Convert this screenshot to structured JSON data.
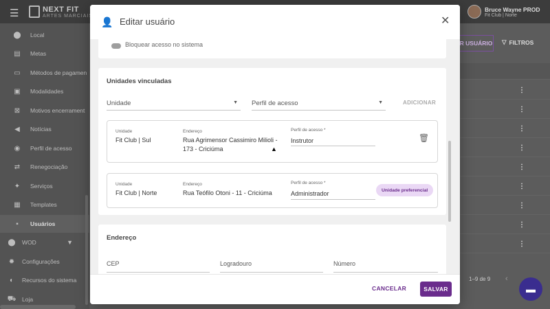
{
  "app": {
    "brand_name": "NEXT FIT",
    "brand_sub": "ARTES MARCIAIS",
    "user_name": "Bruce Wayne PROD",
    "user_unit": "Fit Club | Norte"
  },
  "sidebar": {
    "items": [
      {
        "label": "Local",
        "icon": "pin-icon"
      },
      {
        "label": "Metas",
        "icon": "chart-icon"
      },
      {
        "label": "Métodos de pagamen",
        "icon": "card-icon"
      },
      {
        "label": "Modalidades",
        "icon": "list-icon"
      },
      {
        "label": "Motivos encerrament",
        "icon": "close-box-icon"
      },
      {
        "label": "Notícias",
        "icon": "megaphone-icon"
      },
      {
        "label": "Perfil de acesso",
        "icon": "eye-icon"
      },
      {
        "label": "Renegociação",
        "icon": "swap-icon"
      },
      {
        "label": "Serviços",
        "icon": "wrench-icon"
      },
      {
        "label": "Templates",
        "icon": "template-icon"
      },
      {
        "label": "Usuários",
        "icon": "user-icon"
      },
      {
        "label": "WOD",
        "icon": "dumbbell-icon"
      },
      {
        "label": "Configurações",
        "icon": "gear-icon"
      },
      {
        "label": "Recursos do sistema",
        "icon": "toggle-icon"
      },
      {
        "label": "Loja",
        "icon": "cart-icon"
      }
    ]
  },
  "background": {
    "new_user_btn": "R USUÁRIO",
    "filters_btn": "FILTROS",
    "pagination": "1–9 de 9"
  },
  "modal": {
    "title": "Editar usuário",
    "block_access_label": "Bloquear acesso no sistema",
    "units_section_title": "Unidades vinculadas",
    "unit_select_label": "Unidade",
    "profile_select_label": "Perfil de acesso",
    "add_button": "ADICIONAR",
    "units": [
      {
        "unit_caption": "Unidade",
        "unit_value": "Fit Club | Sul",
        "address_caption": "Endereço",
        "address_value": "Rua Agrimensor Cassimiro Milioli - 173 - Criciúma",
        "profile_caption": "Perfil de acesso *",
        "profile_value": "Instrutor",
        "badge": ""
      },
      {
        "unit_caption": "Unidade",
        "unit_value": "Fit Club | Norte",
        "address_caption": "Endereço",
        "address_value": "Rua Teófilo Otoni - 11 - Criciúma",
        "profile_caption": "Perfil de acesso *",
        "profile_value": "Administrador",
        "badge": "Unidade preferencial"
      }
    ],
    "address_section_title": "Endereço",
    "cep_label": "CEP",
    "street_label": "Logradouro",
    "number_label": "Número",
    "cancel_button": "CANCELAR",
    "save_button": "SALVAR"
  },
  "colors": {
    "accent": "#6a2c8c",
    "badge_bg": "#ead8f5"
  }
}
